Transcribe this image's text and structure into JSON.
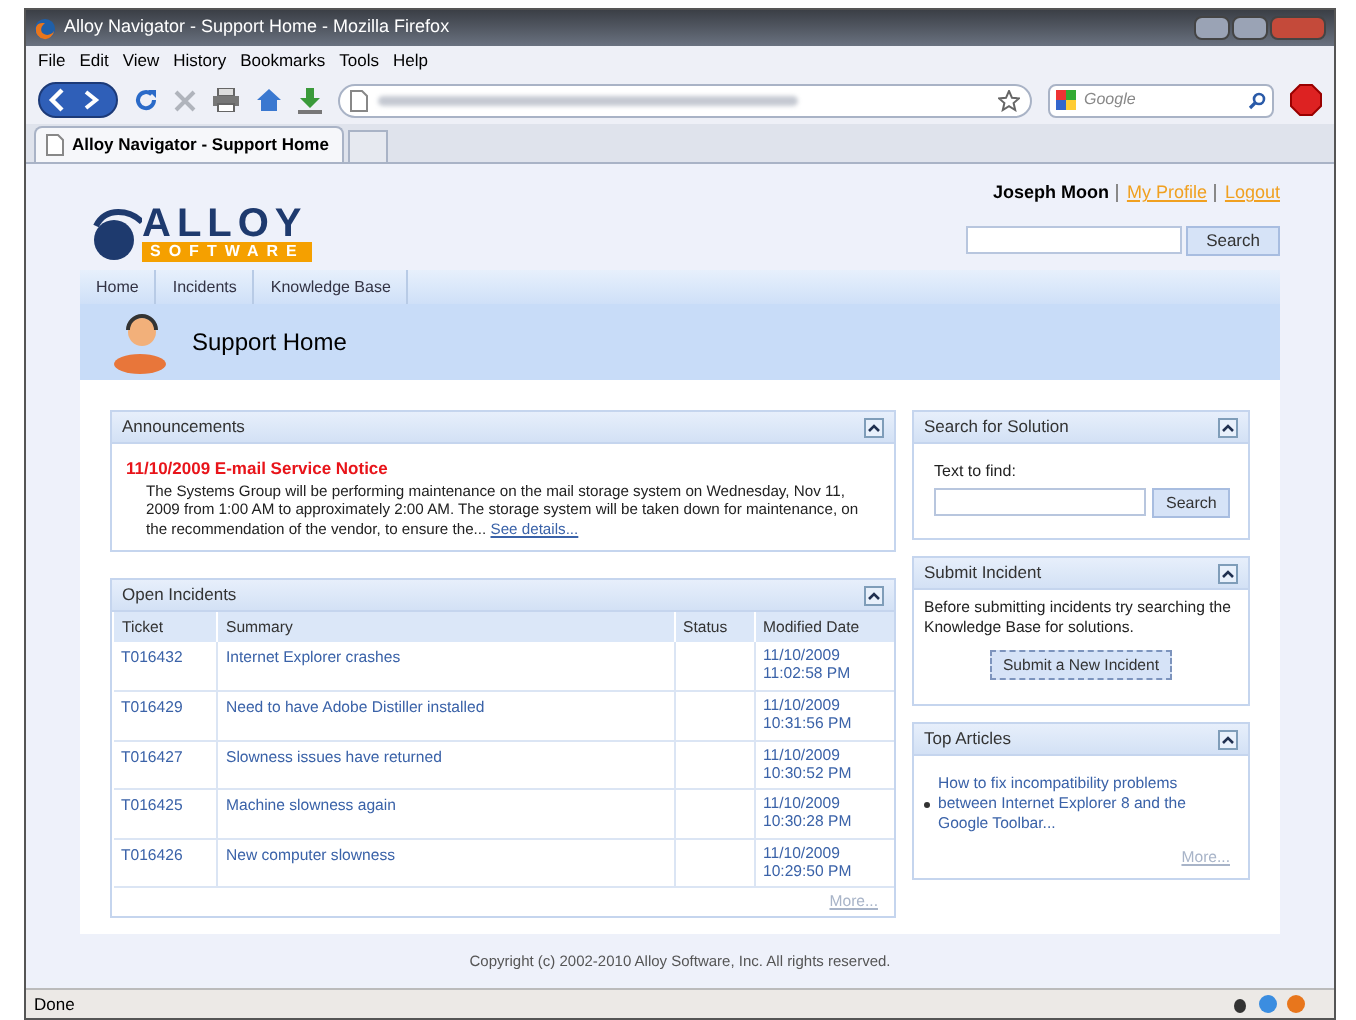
{
  "window": {
    "title": "Alloy Navigator - Support Home - Mozilla Firefox"
  },
  "menu": [
    "File",
    "Edit",
    "View",
    "History",
    "Bookmarks",
    "Tools",
    "Help"
  ],
  "search_engine": {
    "placeholder": "Google"
  },
  "tabs": [
    {
      "label": "Alloy Navigator - Support Home",
      "selected": true
    }
  ],
  "logo": {
    "word": "ALLOY",
    "subword": "SOFTWARE"
  },
  "user": {
    "name": "Joseph Moon",
    "links": [
      "My Profile",
      "Logout"
    ]
  },
  "site_search": {
    "button": "Search"
  },
  "nav": [
    "Home",
    "Incidents",
    "Knowledge Base"
  ],
  "page_title": "Support Home",
  "announcements": {
    "title": "Announcements",
    "headline": "11/10/2009 E-mail Service Notice",
    "body": "The Systems Group will be performing maintenance on the mail storage system on Wednesday, Nov 11, 2009 from 1:00 AM to approximately 2:00 AM. The storage system will be taken down for maintenance, on the recommendation of the vendor, to ensure the...",
    "link": "See details..."
  },
  "incidents": {
    "title": "Open Incidents",
    "columns": [
      "Ticket",
      "Summary",
      "Status",
      "Modified Date"
    ],
    "rows": [
      {
        "ticket": "T016432",
        "summary": "Internet Explorer crashes",
        "date": "11/10/2009",
        "time": "11:02:58 PM"
      },
      {
        "ticket": "T016429",
        "summary": "Need to have Adobe Distiller installed",
        "date": "11/10/2009",
        "time": "10:31:56 PM"
      },
      {
        "ticket": "T016427",
        "summary": "Slowness issues have returned",
        "date": "11/10/2009",
        "time": "10:30:52 PM"
      },
      {
        "ticket": "T016425",
        "summary": "Machine slowness again",
        "date": "11/10/2009",
        "time": "10:30:28 PM"
      },
      {
        "ticket": "T016426",
        "summary": "New computer slowness",
        "date": "11/10/2009",
        "time": "10:29:50 PM"
      }
    ],
    "more": "More..."
  },
  "solution_search": {
    "title": "Search for Solution",
    "label": "Text to find:",
    "button": "Search"
  },
  "submit_incident": {
    "title": "Submit Incident",
    "text": "Before submitting incidents try searching the Knowledge Base for solutions.",
    "button": "Submit a New Incident"
  },
  "top_articles": {
    "title": "Top Articles",
    "items": [
      "How to fix incompatibility problems between Internet Explorer 8 and the Google Toolbar..."
    ],
    "more": "More..."
  },
  "footer": "Copyright (c) 2002-2010 Alloy Software, Inc. All rights reserved.",
  "status_bar": "Done"
}
